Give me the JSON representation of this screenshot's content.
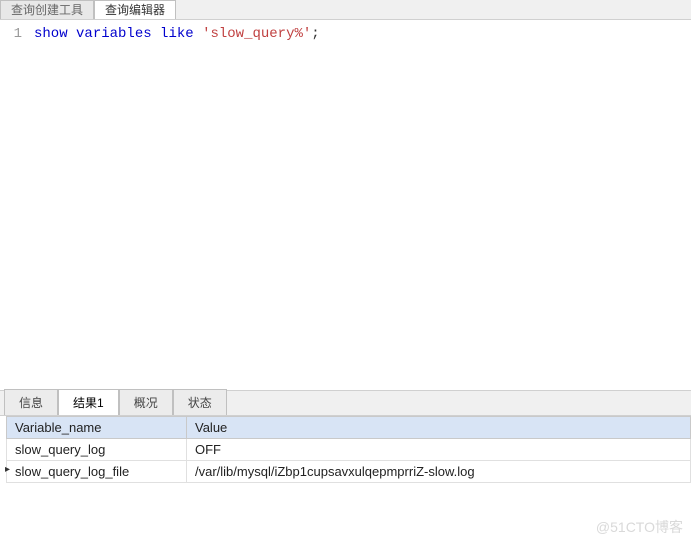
{
  "topTabs": {
    "builder": "查询创建工具",
    "editor": "查询编辑器"
  },
  "editor": {
    "lineNumber": "1",
    "sql": {
      "kw1": "show",
      "kw2": "variables",
      "kw3": "like",
      "str": "'slow_query%'",
      "semi": ";"
    }
  },
  "bottomTabs": {
    "info": "信息",
    "result1": "结果1",
    "profile": "概况",
    "status": "状态"
  },
  "resultHeaders": {
    "col0": "Variable_name",
    "col1": "Value"
  },
  "resultRows": [
    {
      "name": "slow_query_log",
      "value": "OFF"
    },
    {
      "name": "slow_query_log_file",
      "value": "/var/lib/mysql/iZbp1cupsavxulqepmprriZ-slow.log"
    }
  ],
  "watermark": "@51CTO博客"
}
